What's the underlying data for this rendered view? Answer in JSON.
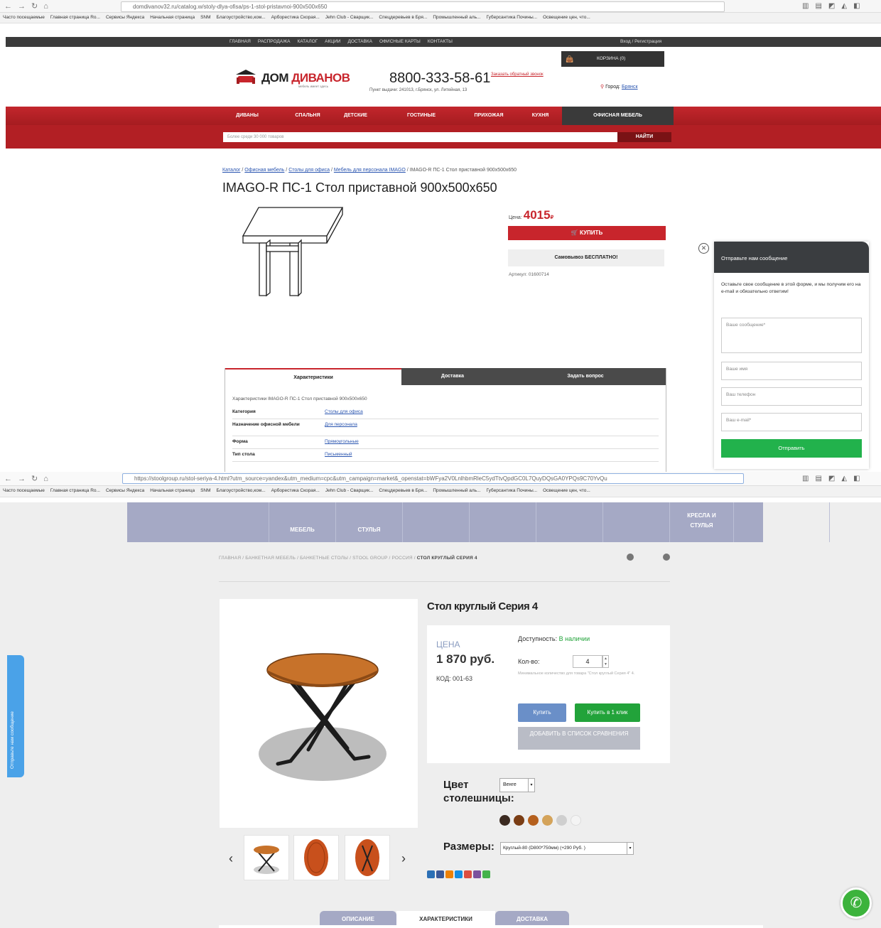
{
  "browser1": {
    "url": "domdivanov32.ru/catalog.w/stoly-dlya-ofisa/ps-1-stol-pristavnoi-900x500x650",
    "bookmarks": [
      "Часто посещаемые",
      "Главная страница Ro...",
      "Сервисы Яндекса",
      "Начальная страница",
      "SNM",
      "Благоустройство,ком...",
      "Арборестика Скорая...",
      "Jehn Club - Сварщик...",
      "Спецдеревьев в Бря...",
      "Промышленный аль...",
      "Губерсантика Почины...",
      "Освещение цен, что..."
    ]
  },
  "site1": {
    "topmenu": [
      "ГЛАВНАЯ",
      "РАСПРОДАЖА",
      "КАТАЛОГ",
      "АКЦИИ",
      "ДОСТАВКА",
      "ОФИСНЫЕ КАРТЫ",
      "КОНТАКТЫ"
    ],
    "login": "Вход / Регистрация",
    "cart": "КОРЗИНА (0)",
    "logo_a": "ДОМ",
    "logo_b": "ДИВАНОВ",
    "logo_sub": "мебель имеет здесь",
    "phone": "8800-333-58-61",
    "callback": "Заказать обратный звонок",
    "address": "Пункт выдачи: 241013, г.Брянск, ул. Литейная, 13",
    "city_label": "Город:",
    "city": "Брянск",
    "nav": [
      "ДИВАНЫ",
      "СПАЛЬНЯ",
      "ДЕТСКИЕ",
      "ГОСТИНЫЕ",
      "ПРИХОЖАЯ",
      "КУХНЯ",
      "ОФИСНАЯ МЕБЕЛЬ"
    ],
    "search_placeholder": "Более среди 30 000 товаров",
    "search_button": "НАЙТИ",
    "breadcrumb": [
      "Каталог",
      "Офисная мебель",
      "Столы для офиса",
      "Мебель для персонала IMAGO"
    ],
    "breadcrumb_current": "IMAGO-R ПС-1 Стол приставной 900x500x650",
    "title": "IMAGO-R ПС-1 Стол приставной 900x500x650",
    "price_label": "Цена:",
    "price": "4015",
    "currency": "₽",
    "buy": "КУПИТЬ",
    "pickup": "Самовывоз БЕСПЛАТНО!",
    "article": "Артикул: 01600714",
    "tabs": [
      "Характеристики",
      "Доставка",
      "Задать вопрос"
    ],
    "specs_title": "Характеристики IMAGO-R ПС-1 Стол приставной 900x500x650",
    "specs": [
      {
        "k": "Категория",
        "v": "Столы для офиса"
      },
      {
        "k": "Назначение офисной мебели",
        "v": "Для персонала"
      },
      {
        "k": "Форма",
        "v": "Прямоугольные"
      },
      {
        "k": "Тип стола",
        "v": "Письменный"
      }
    ]
  },
  "chat": {
    "header": "Отправьте нам сообщение",
    "text": "Оставьте свое сообщение в этой форме, и мы получим его на e-mail и обязательно ответим!",
    "message_ph": "Ваше сообщение*",
    "name_ph": "Ваше имя",
    "phone_ph": "Ваш телефон",
    "email_ph": "Ваш e-mail*",
    "send": "Отправить"
  },
  "browser2": {
    "url": "https://stoolgroup.ru/stol-seriya-4.html?utm_source=yandex&utm_medium=cpc&utm_campaign=market&_openstat=bWFya2V0LnlhbmRleC5ydTtvQpdGC0L7QuyDQsGA0YPQs9C70YvQu"
  },
  "site2": {
    "catnav": [
      {
        "l1": "",
        "l2": ""
      },
      {
        "l1": "МЕБЕЛЬ",
        "l2": ""
      },
      {
        "l1": "СТУЛЬЯ",
        "l2": ""
      },
      {
        "l1": "",
        "l2": ""
      },
      {
        "l1": "",
        "l2": ""
      },
      {
        "l1": "",
        "l2": ""
      },
      {
        "l1": "",
        "l2": ""
      },
      {
        "l1": "КРЕСЛА И",
        "l2": "СТУЛЬЯ"
      },
      {
        "l1": "",
        "l2": ""
      }
    ],
    "breadcrumb": "ГЛАВНАЯ  /  БАНКЕТНАЯ МЕБЕЛЬ  /  БАНКЕТНЫЕ СТОЛЫ  /  STOOL GROUP  /  РОССИЯ  /",
    "breadcrumb_current": "СТОЛ КРУГЛЫЙ СЕРИЯ 4",
    "title": "Стол круглый Серия 4",
    "price_label": "ЦЕНА",
    "price": "1 870 руб.",
    "code": "КОД: 001-63",
    "availability_label": "Доступность:",
    "availability": "В наличии",
    "qty_label": "Кол-во:",
    "qty": "4",
    "min_note": "Минимальное количество для товара \"Стол круглый Серия 4\" 4.",
    "buy": "Купить",
    "buy_one": "Купить в 1 клик",
    "compare": "ДОБАВИТЬ В СПИСОК СРАВНЕНИЯ",
    "color_label": "Цвет столешницы:",
    "color_value": "Венге",
    "swatches": [
      "#3b2a20",
      "#7a3d14",
      "#b5601d",
      "#d4a35a",
      "#cfcfcf",
      "#f4f4f4"
    ],
    "size_label": "Размеры:",
    "size_value": "Круглый-80 (D800*750мм) (+290 Руб. )",
    "tabs": [
      "ОПИСАНИЕ",
      "ХАРАКТЕРИСТИКИ",
      "ДОСТАВКА"
    ],
    "side_widget": "Отправьте нам сообщение",
    "prev": "‹",
    "next": "›"
  }
}
